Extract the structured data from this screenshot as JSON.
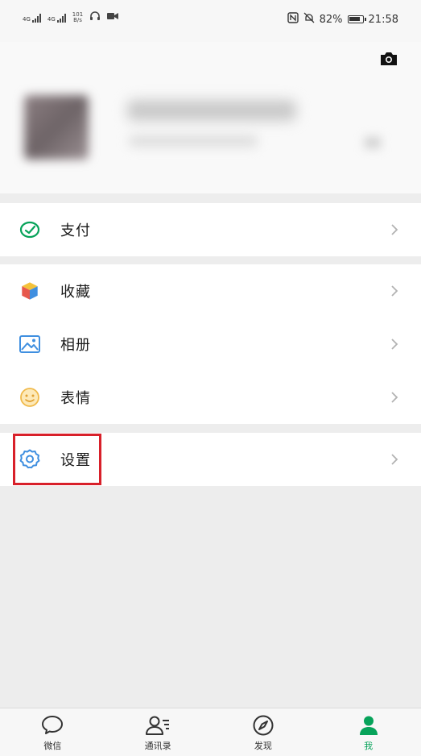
{
  "status_bar": {
    "network_left": "4G",
    "network_right": "4G",
    "speed_value": "101",
    "speed_unit": "B/s",
    "battery": "82%",
    "time": "21:58"
  },
  "profile": {
    "camera_icon": "camera-icon"
  },
  "menu": {
    "pay": {
      "label": "支付",
      "icon": "wallet-icon"
    },
    "favorites": {
      "label": "收藏",
      "icon": "cube-icon"
    },
    "album": {
      "label": "相册",
      "icon": "image-icon"
    },
    "stickers": {
      "label": "表情",
      "icon": "smiley-icon"
    },
    "settings": {
      "label": "设置",
      "icon": "gear-icon"
    }
  },
  "tabbar": {
    "tabs": [
      {
        "label": "微信",
        "icon": "chat-bubble-icon"
      },
      {
        "label": "通讯录",
        "icon": "contacts-icon"
      },
      {
        "label": "发现",
        "icon": "compass-icon"
      },
      {
        "label": "我",
        "icon": "person-icon"
      }
    ],
    "active_index": 3
  },
  "colors": {
    "accent": "#07a35a",
    "highlight": "#d8202a",
    "background": "#ededed"
  }
}
